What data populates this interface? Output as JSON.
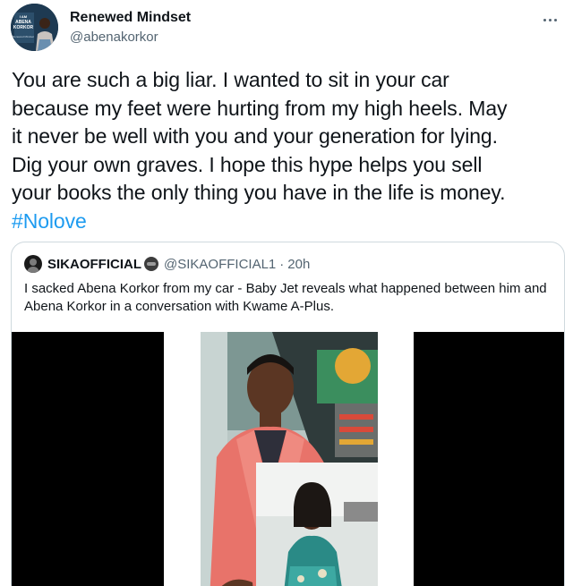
{
  "tweet": {
    "display_name": "Renewed Mindset",
    "handle": "@abenakorkor",
    "avatar_text": [
      "I AM",
      "ABENA",
      "KORKOR",
      "Renewed Mindset"
    ],
    "text_lines": [
      "You are such a big liar. I wanted to sit in your car",
      "because my feet were hurting from my high heels. May",
      "it never be well with you and your generation for lying.",
      "Dig your own graves. I hope this hype helps you sell",
      "your books the only thing you have in the life is money."
    ],
    "hashtag": "#Nolove",
    "more_icon": "more-horizontal-icon"
  },
  "quoted_tweet": {
    "name": "SIKAOFFICIAL",
    "handle": "@SIKAOFFICIAL1",
    "separator": "·",
    "time": "20h",
    "text": "I sacked Abena Korkor from my car - Baby Jet reveals what happened between him and Abena Korkor in a conversation with Kwame A-Plus.",
    "emoji_icon": "gorilla-emoji-icon",
    "media_colors": {
      "letterbox": "#000000",
      "blazer": "#e8736a",
      "dress": "#2a8a86"
    }
  },
  "colors": {
    "text": "#0f1419",
    "secondary": "#536471",
    "link": "#1d9bf0",
    "border": "#cfd9de"
  }
}
